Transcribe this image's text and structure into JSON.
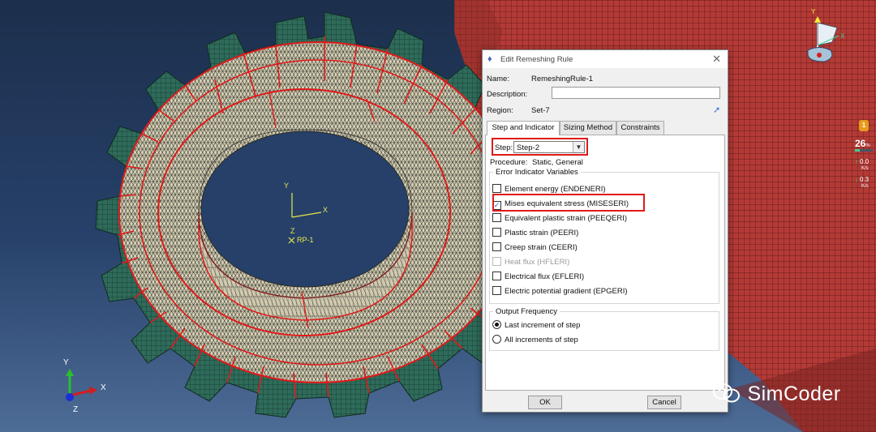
{
  "viewport": {
    "model_csys": {
      "x": "X",
      "y": "Y",
      "z": "Z",
      "ref_point": "RP-1"
    },
    "triad": {
      "x": "X",
      "y": "Y",
      "z": "Z"
    },
    "view_cube": {
      "x": "X",
      "y": "Y"
    }
  },
  "dialog": {
    "title": "Edit Remeshing Rule",
    "name_label": "Name:",
    "name_value": "RemeshingRule-1",
    "description_label": "Description:",
    "description_value": "",
    "region_label": "Region:",
    "region_value": "Set-7",
    "tabs": [
      {
        "label": "Step and Indicator",
        "active": true
      },
      {
        "label": "Sizing Method",
        "active": false
      },
      {
        "label": "Constraints",
        "active": false
      }
    ],
    "step_label": "Step:",
    "step_value": "Step-2",
    "procedure_label": "Procedure:",
    "procedure_value": "Static, General",
    "error_group_title": "Error Indicator Variables",
    "error_variables": [
      {
        "label": "Element energy (ENDENERI)",
        "checked": false,
        "enabled": true
      },
      {
        "label": "Mises equivalent stress (MISESERI)",
        "checked": true,
        "enabled": true
      },
      {
        "label": "Equivalent plastic strain (PEEQERI)",
        "checked": false,
        "enabled": true
      },
      {
        "label": "Plastic strain (PEERI)",
        "checked": false,
        "enabled": true
      },
      {
        "label": "Creep strain (CEERI)",
        "checked": false,
        "enabled": true
      },
      {
        "label": "Heat flux (HFLERI)",
        "checked": false,
        "enabled": false
      },
      {
        "label": "Electrical flux (EFLERI)",
        "checked": false,
        "enabled": true
      },
      {
        "label": "Electric potential gradient (EPGERI)",
        "checked": false,
        "enabled": true
      }
    ],
    "output_group_title": "Output Frequency",
    "output_options": [
      {
        "label": "Last increment of step",
        "selected": true
      },
      {
        "label": "All increments of step",
        "selected": false
      }
    ],
    "ok_label": "OK",
    "cancel_label": "Cancel"
  },
  "perf_widget": {
    "badge": "1",
    "value": "26",
    "unit": "%",
    "usage_fraction": 0.26,
    "upload_value": "0.0",
    "upload_unit": "K/s",
    "download_value": "0.3",
    "download_unit": "K/s"
  },
  "watermark": "SimCoder",
  "colors": {
    "background_top": "#1c2f4c",
    "gear_green": "#2e6b5a",
    "mesh_face": "#d8d2b6",
    "red_gear": "#b33b38",
    "highlight_red": "#e01a1a",
    "annotation_yellow": "#e8e84a"
  }
}
